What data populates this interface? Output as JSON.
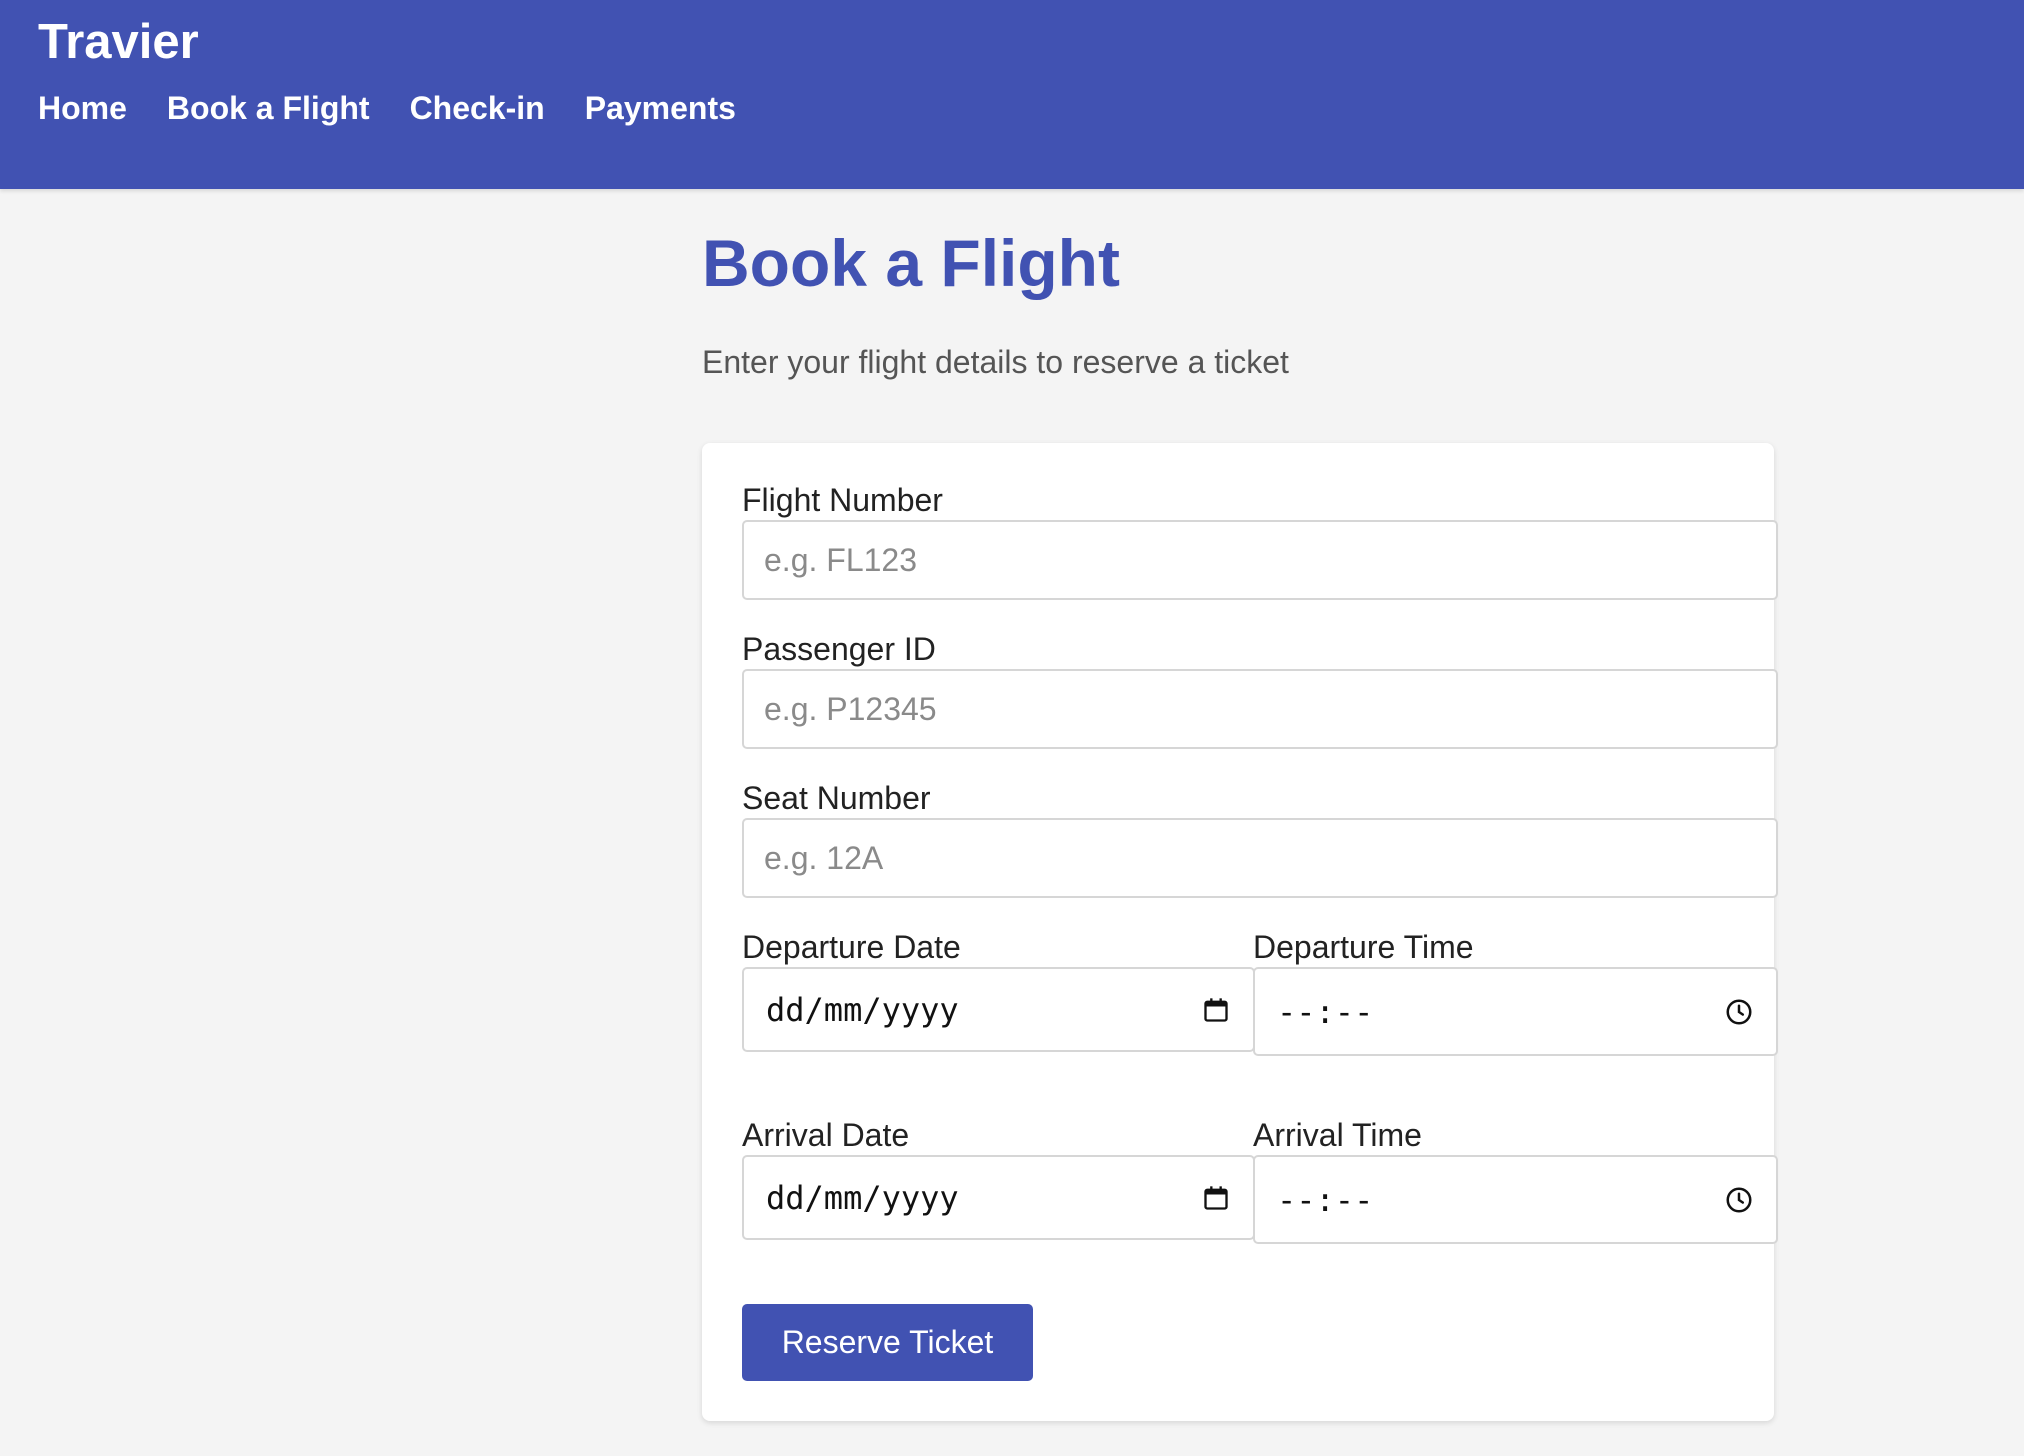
{
  "header": {
    "brand": "Travier",
    "nav": [
      "Home",
      "Book a Flight",
      "Check-in",
      "Payments"
    ]
  },
  "main": {
    "title": "Book a Flight",
    "subtitle": "Enter your flight details to reserve a ticket"
  },
  "form": {
    "flight_number": {
      "label": "Flight Number",
      "placeholder": "e.g. FL123"
    },
    "passenger_id": {
      "label": "Passenger ID",
      "placeholder": "e.g. P12345"
    },
    "seat_number": {
      "label": "Seat Number",
      "placeholder": "e.g. 12A"
    },
    "departure_date": {
      "label": "Departure Date",
      "value": "dd/mm/yyyy",
      "icon": "calendar-icon"
    },
    "departure_time": {
      "label": "Departure Time",
      "value": "--:--",
      "icon": "clock-icon"
    },
    "arrival_date": {
      "label": "Arrival Date",
      "value": "dd/mm/yyyy",
      "icon": "calendar-icon"
    },
    "arrival_time": {
      "label": "Arrival Time",
      "value": "--:--",
      "icon": "clock-icon"
    },
    "submit_label": "Reserve Ticket"
  },
  "colors": {
    "primary": "#4152b2",
    "background": "#f4f4f4",
    "card": "#ffffff"
  }
}
